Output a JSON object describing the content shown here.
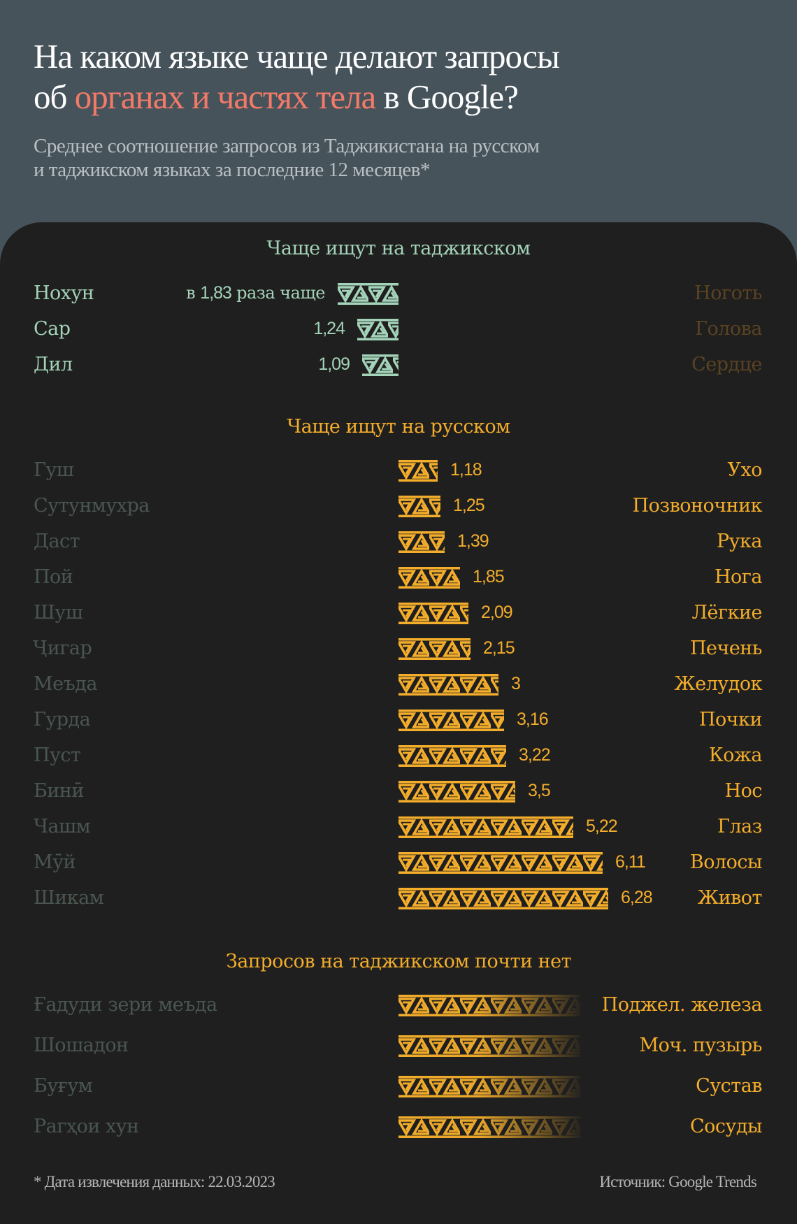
{
  "header": {
    "title_line1": "На каком языке чаще делают запросы",
    "title_line2_prefix": "об ",
    "title_line2_highlight": "органах и частях тела",
    "title_line2_suffix": " в Google?",
    "subtitle_line1": "Среднее соотношение запросов из Таджикистана на русском",
    "subtitle_line2": "и таджикском языках за последние 12 месяцев*"
  },
  "colors": {
    "header_bg": "#46535b",
    "card_bg": "#1f1f1f",
    "title_highlight": "#f47a68",
    "tajik_green": "#a3d3b9",
    "russian_orange": "#f3ad2b"
  },
  "chart_data": {
    "type": "bar",
    "title": "На каком языке чаще делают запросы об органах и частях тела в Google?",
    "subtitle": "Среднее соотношение запросов из Таджикистана на русском и таджикском языках за последние 12 месяцев*",
    "unit": "ratio (раз чаще)",
    "sections": [
      {
        "name": "Чаще ищут на таджикском",
        "direction": "tajik",
        "value_prefix": "в ",
        "value_suffix": " раза чаще",
        "rows": [
          {
            "tajik": "Нохун",
            "russian": "Ноготь",
            "value": 1.83,
            "label": "1,83"
          },
          {
            "tajik": "Сар",
            "russian": "Голова",
            "value": 1.24,
            "label": "1,24"
          },
          {
            "tajik": "Дил",
            "russian": "Сердце",
            "value": 1.09,
            "label": "1,09"
          }
        ]
      },
      {
        "name": "Чаще ищут на русском",
        "direction": "russian",
        "rows": [
          {
            "tajik": "Гуш",
            "russian": "Ухо",
            "value": 1.18,
            "label": "1,18"
          },
          {
            "tajik": "Сутунмухра",
            "russian": "Позвоночник",
            "value": 1.25,
            "label": "1,25"
          },
          {
            "tajik": "Даст",
            "russian": "Рука",
            "value": 1.39,
            "label": "1,39"
          },
          {
            "tajik": "Пой",
            "russian": "Нога",
            "value": 1.85,
            "label": "1,85"
          },
          {
            "tajik": "Шуш",
            "russian": "Лёгкие",
            "value": 2.09,
            "label": "2,09"
          },
          {
            "tajik": "Ҷигар",
            "russian": "Печень",
            "value": 2.15,
            "label": "2,15"
          },
          {
            "tajik": "Меъда",
            "russian": "Желудок",
            "value": 3,
            "label": "3"
          },
          {
            "tajik": "Гурда",
            "russian": "Почки",
            "value": 3.16,
            "label": "3,16"
          },
          {
            "tajik": "Пуст",
            "russian": "Кожа",
            "value": 3.22,
            "label": "3,22"
          },
          {
            "tajik": "Бинӣ",
            "russian": "Нос",
            "value": 3.5,
            "label": "3,5"
          },
          {
            "tajik": "Чашм",
            "russian": "Глаз",
            "value": 5.22,
            "label": "5,22"
          },
          {
            "tajik": "Мӯй",
            "russian": "Волосы",
            "value": 6.11,
            "label": "6,11"
          },
          {
            "tajik": "Шикам",
            "russian": "Живот",
            "value": 6.28,
            "label": "6,28"
          }
        ]
      },
      {
        "name": "Запросов на таджикском почти нет",
        "direction": "russian-only",
        "rows": [
          {
            "tajik": "Ғадуди зери меъда",
            "russian": "Поджел. железа",
            "value": null,
            "label": ""
          },
          {
            "tajik": "Шошадон",
            "russian": "Моч. пузырь",
            "value": null,
            "label": ""
          },
          {
            "tajik": "Буғум",
            "russian": "Сустав",
            "value": null,
            "label": ""
          },
          {
            "tajik": "Рагҳои хун",
            "russian": "Сосуды",
            "value": null,
            "label": ""
          }
        ]
      }
    ]
  },
  "footer": {
    "note": "* Дата извлечения данных: 22.03.2023",
    "source": "Источник: Google Trends"
  }
}
